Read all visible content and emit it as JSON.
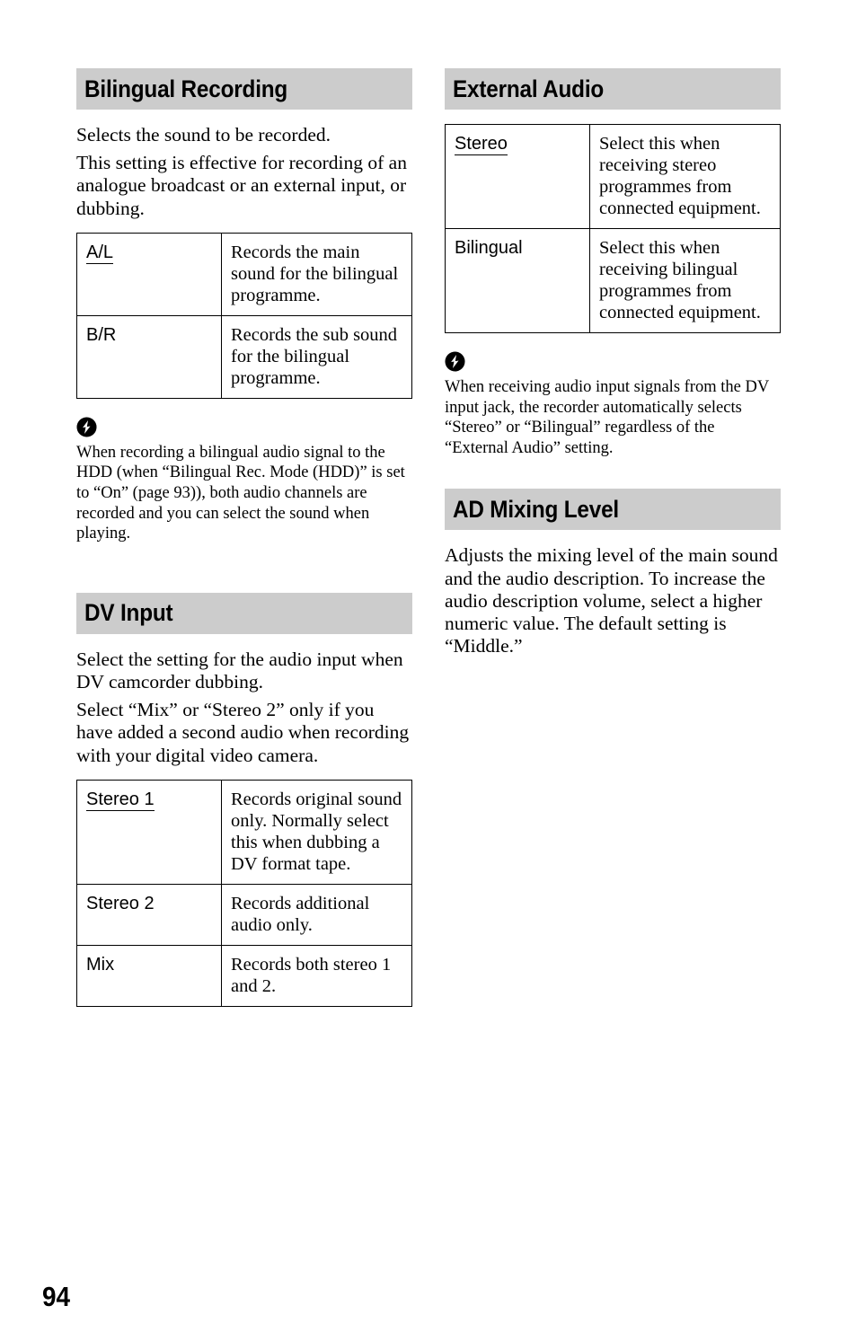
{
  "page": {
    "number": "94"
  },
  "icons": {
    "note": "note-lightning-icon"
  },
  "left_column": {
    "sections": [
      {
        "heading": "Bilingual Recording",
        "paragraphs": [
          "Selects the sound to be recorded.",
          "This setting is effective for recording of an analogue broadcast or an external input, or dubbing."
        ],
        "table": {
          "rows": [
            {
              "key": "A/L",
              "key_underlined": true,
              "value": "Records the main sound for the bilingual programme."
            },
            {
              "key": "B/R",
              "key_underlined": false,
              "value": "Records the sub sound for the bilingual programme."
            }
          ]
        },
        "note": "When recording a bilingual audio signal to the HDD (when “Bilingual Rec. Mode (HDD)” is set to “On” (page 93)), both audio channels are recorded and you can select the sound when playing."
      },
      {
        "heading": "DV Input",
        "paragraphs": [
          "Select the setting for the audio input when DV camcorder dubbing.",
          "Select “Mix” or “Stereo 2” only if you have added a second audio when recording with your digital video camera."
        ],
        "table": {
          "rows": [
            {
              "key": "Stereo 1",
              "key_underlined": true,
              "value": "Records original sound only. Normally select this when dubbing a DV format tape."
            },
            {
              "key": "Stereo 2",
              "key_underlined": false,
              "value": "Records additional audio only."
            },
            {
              "key": "Mix",
              "key_underlined": false,
              "value": "Records both stereo 1 and 2."
            }
          ]
        }
      }
    ]
  },
  "right_column": {
    "sections": [
      {
        "heading": "External Audio",
        "table": {
          "rows": [
            {
              "key": "Stereo",
              "key_underlined": true,
              "value": "Select this when receiving stereo programmes from connected equipment."
            },
            {
              "key": "Bilingual",
              "key_underlined": false,
              "value": "Select this when receiving bilingual programmes from connected equipment."
            }
          ]
        },
        "note": "When receiving audio input signals from the DV input jack, the recorder automatically selects “Stereo” or “Bilingual” regardless of the “External Audio” setting."
      },
      {
        "heading": "AD Mixing Level",
        "paragraphs": [
          "Adjusts the mixing level of the main sound and the audio description. To increase the audio description volume, select a higher numeric value. The default setting is “Middle.”"
        ]
      }
    ]
  },
  "colors": {
    "heading_band": "#cccccc",
    "text": "#000000",
    "table_border": "#000000"
  }
}
